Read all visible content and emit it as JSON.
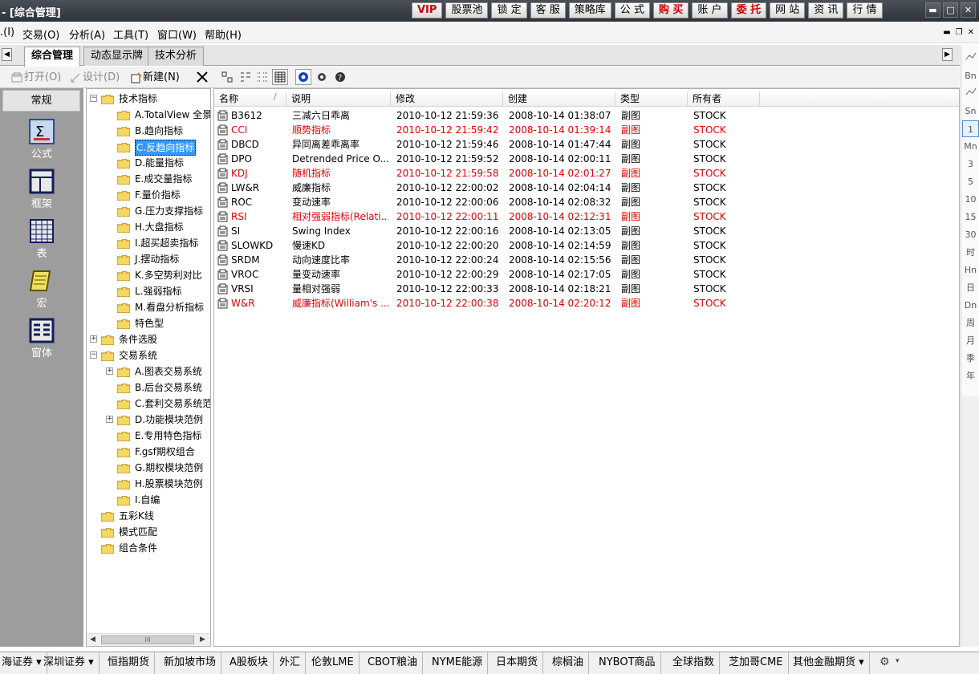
{
  "titlebar": {
    "title": "- [综合管理]",
    "buttons": [
      "VIP",
      "股票池",
      "锁 定",
      "客 服",
      "策略库",
      "公 式",
      "购 买",
      "账 户",
      "委 托",
      "网 站",
      "资 讯",
      "行 情"
    ],
    "red_buttons": [
      "VIP",
      "购 买",
      "委 托"
    ]
  },
  "menubar": {
    "items": [
      ".(I)",
      "交易(O)",
      "分析(A)",
      "工具(T)",
      "窗口(W)",
      "帮助(H)"
    ]
  },
  "tabs": [
    "综合管理",
    "动态显示牌",
    "技术分析"
  ],
  "toolbar": {
    "open_label": "打开(O)",
    "design_label": "设计(D)",
    "new_label": "新建(N)"
  },
  "leftpanel": {
    "header": "常规",
    "items": [
      "公式",
      "框架",
      "表",
      "宏",
      "窗体"
    ]
  },
  "tree": [
    {
      "label": "技术指标",
      "level": 0,
      "expander": "−"
    },
    {
      "label": "A.TotalView 全景",
      "level": 1
    },
    {
      "label": "B.趋向指标",
      "level": 1
    },
    {
      "label": "C.反趋向指标",
      "level": 1,
      "selected": true
    },
    {
      "label": "D.能量指标",
      "level": 1
    },
    {
      "label": "E.成交量指标",
      "level": 1
    },
    {
      "label": "F.量价指标",
      "level": 1
    },
    {
      "label": "G.压力支撑指标",
      "level": 1
    },
    {
      "label": "H.大盘指标",
      "level": 1
    },
    {
      "label": "I.超买超卖指标",
      "level": 1
    },
    {
      "label": "J.摆动指标",
      "level": 1
    },
    {
      "label": "K.多空势利对比",
      "level": 1
    },
    {
      "label": "L.强弱指标",
      "level": 1
    },
    {
      "label": "M.看盘分析指标",
      "level": 1
    },
    {
      "label": "特色型",
      "level": 1
    },
    {
      "label": "条件选股",
      "level": 0,
      "expander": "+"
    },
    {
      "label": "交易系统",
      "level": 0,
      "expander": "−"
    },
    {
      "label": "A.图表交易系统",
      "level": 1,
      "expander": "+"
    },
    {
      "label": "B.后台交易系统",
      "level": 1
    },
    {
      "label": "C.套利交易系统范",
      "level": 1
    },
    {
      "label": "D.功能模块范例",
      "level": 1,
      "expander": "+"
    },
    {
      "label": "E.专用特色指标",
      "level": 1
    },
    {
      "label": "F.gsf期权组合",
      "level": 1
    },
    {
      "label": "G.期权模块范例",
      "level": 1
    },
    {
      "label": "H.股票模块范例",
      "level": 1
    },
    {
      "label": "I.自编",
      "level": 1
    },
    {
      "label": "五彩K线",
      "level": 0
    },
    {
      "label": "模式匹配",
      "level": 0
    },
    {
      "label": "组合条件",
      "level": 0
    }
  ],
  "list": {
    "columns": [
      "名称",
      "说明",
      "修改",
      "创建",
      "类型",
      "所有者"
    ],
    "rows": [
      {
        "name": "B3612",
        "desc": "三减六日乖离",
        "modified": "2010-10-12 21:59:36",
        "created": "2008-10-14 01:38:07",
        "type": "副图",
        "owner": "STOCK",
        "red": false
      },
      {
        "name": "CCI",
        "desc": "顺势指标",
        "modified": "2010-10-12 21:59:42",
        "created": "2008-10-14 01:39:14",
        "type": "副图",
        "owner": "STOCK",
        "red": true
      },
      {
        "name": "DBCD",
        "desc": "异同离差乖离率",
        "modified": "2010-10-12 21:59:46",
        "created": "2008-10-14 01:47:44",
        "type": "副图",
        "owner": "STOCK",
        "red": false
      },
      {
        "name": "DPO",
        "desc": "Detrended Price O...",
        "modified": "2010-10-12 21:59:52",
        "created": "2008-10-14 02:00:11",
        "type": "副图",
        "owner": "STOCK",
        "red": false
      },
      {
        "name": "KDJ",
        "desc": "随机指标",
        "modified": "2010-10-12 21:59:58",
        "created": "2008-10-14 02:01:27",
        "type": "副图",
        "owner": "STOCK",
        "red": true
      },
      {
        "name": "LW&R",
        "desc": "威廉指标",
        "modified": "2010-10-12 22:00:02",
        "created": "2008-10-14 02:04:14",
        "type": "副图",
        "owner": "STOCK",
        "red": false
      },
      {
        "name": "ROC",
        "desc": "变动速率",
        "modified": "2010-10-12 22:00:06",
        "created": "2008-10-14 02:08:32",
        "type": "副图",
        "owner": "STOCK",
        "red": false
      },
      {
        "name": "RSI",
        "desc": "相对强弱指标(Relati...",
        "modified": "2010-10-12 22:00:11",
        "created": "2008-10-14 02:12:31",
        "type": "副图",
        "owner": "STOCK",
        "red": true
      },
      {
        "name": "SI",
        "desc": "Swing Index",
        "modified": "2010-10-12 22:00:16",
        "created": "2008-10-14 02:13:05",
        "type": "副图",
        "owner": "STOCK",
        "red": false
      },
      {
        "name": "SLOWKD",
        "desc": "慢速KD",
        "modified": "2010-10-12 22:00:20",
        "created": "2008-10-14 02:14:59",
        "type": "副图",
        "owner": "STOCK",
        "red": false
      },
      {
        "name": "SRDM",
        "desc": "动向速度比率",
        "modified": "2010-10-12 22:00:24",
        "created": "2008-10-14 02:15:56",
        "type": "副图",
        "owner": "STOCK",
        "red": false
      },
      {
        "name": "VROC",
        "desc": "量变动速率",
        "modified": "2010-10-12 22:00:29",
        "created": "2008-10-14 02:17:05",
        "type": "副图",
        "owner": "STOCK",
        "red": false
      },
      {
        "name": "VRSI",
        "desc": "量相对强弱",
        "modified": "2010-10-12 22:00:33",
        "created": "2008-10-14 02:18:21",
        "type": "副图",
        "owner": "STOCK",
        "red": false
      },
      {
        "name": "W&R",
        "desc": "威廉指标(William's ...",
        "modified": "2010-10-12 22:00:38",
        "created": "2008-10-14 02:20:12",
        "type": "副图",
        "owner": "STOCK",
        "red": true
      }
    ]
  },
  "rightbar": {
    "items": [
      "",
      "Bn",
      "",
      "Sn",
      "1",
      "Mn",
      "3",
      "5",
      "10",
      "15",
      "30",
      "时",
      "Hn",
      "日",
      "Dn",
      "周",
      "月",
      "季",
      "年"
    ],
    "active": "1"
  },
  "bottombar": {
    "items": [
      "海证券 ▾",
      "深圳证券 ▾",
      "恒指期货",
      "新加坡市场",
      "A股板块",
      "外汇",
      "伦敦LME",
      "CBOT粮油",
      "NYME能源",
      "日本期货",
      "棕榈油",
      "NYBOT商品",
      "全球指数",
      "芝加哥CME",
      "其他金融期货 ▾"
    ]
  },
  "colors": {
    "red": "#e00000",
    "selection": "#3399ff",
    "titlebar": "#3a3f44"
  }
}
